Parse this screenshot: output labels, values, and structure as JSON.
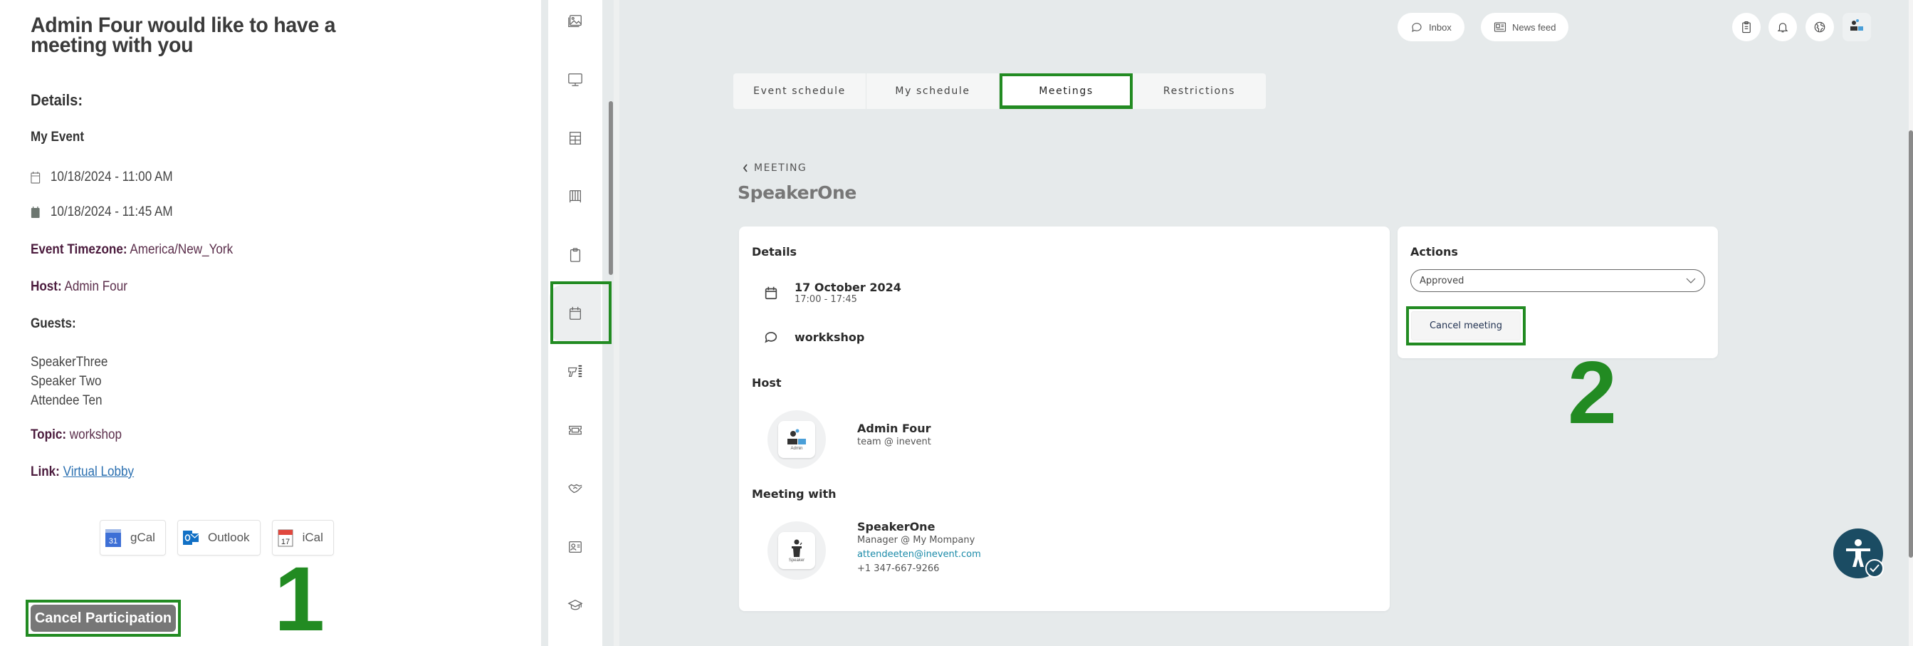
{
  "email": {
    "title": "Admin Four would like to have a meeting with you",
    "details_heading": "Details:",
    "event_name": "My Event",
    "start": "10/18/2024 - 11:00 AM",
    "end": "10/18/2024 - 11:45 AM",
    "timezone_label": "Event Timezone:",
    "timezone_value": "America/New_York",
    "host_label": "Host:",
    "host_value": "Admin Four",
    "guests_label": "Guests:",
    "guests": [
      "SpeakerThree",
      "Speaker Two",
      "Attendee Ten"
    ],
    "topic_label": "Topic:",
    "topic_value": "workshop",
    "link_label": "Link:",
    "link_text": "Virtual Lobby",
    "calendar_buttons": [
      {
        "label": "gCal",
        "icon": "google-calendar-icon"
      },
      {
        "label": "Outlook",
        "icon": "outlook-icon"
      },
      {
        "label": "iCal",
        "icon": "ical-icon"
      }
    ],
    "cancel_label": "Cancel Participation",
    "step_marker": "1"
  },
  "rail": {
    "items": [
      {
        "icon": "image-gallery-icon"
      },
      {
        "icon": "monitor-icon"
      },
      {
        "icon": "table-icon"
      },
      {
        "icon": "columns-icon"
      },
      {
        "icon": "clipboard-icon"
      },
      {
        "icon": "calendar-icon",
        "active": true
      },
      {
        "icon": "scanner-icon"
      },
      {
        "icon": "ticket-icon"
      },
      {
        "icon": "handshake-icon"
      },
      {
        "icon": "contact-card-icon"
      },
      {
        "icon": "graduation-cap-icon"
      }
    ]
  },
  "topbar": {
    "inbox_label": "Inbox",
    "newsfeed_label": "News feed",
    "icons": [
      "clipboard-list-icon",
      "bell-icon",
      "globe-icon",
      "user-avatar"
    ]
  },
  "tabs": [
    {
      "label": "Event schedule",
      "active": false
    },
    {
      "label": "My schedule",
      "active": false
    },
    {
      "label": "Meetings",
      "active": true
    },
    {
      "label": "Restrictions",
      "active": false
    }
  ],
  "breadcrumb": "MEETING",
  "page_title": "SpeakerOne",
  "details_card": {
    "heading": "Details",
    "date": "17 October 2024",
    "time": "17:00 - 17:45",
    "topic": "workkshop",
    "host_heading": "Host",
    "host": {
      "name": "Admin Four",
      "line": "team @ inevent",
      "avatar_caption": "Admin"
    },
    "meeting_with_heading": "Meeting with",
    "guest": {
      "name": "SpeakerOne",
      "role": "Manager @ My Mompany",
      "email": "attendeeten@inevent.com",
      "phone": "+1 347-667-9266",
      "avatar_caption": "Speaker"
    }
  },
  "actions_card": {
    "heading": "Actions",
    "status_value": "Approved",
    "cancel_label": "Cancel meeting",
    "step_marker": "2"
  },
  "colors": {
    "highlight": "#228b22",
    "accessibility": "#1b4c63",
    "link": "#1a8aa8"
  }
}
